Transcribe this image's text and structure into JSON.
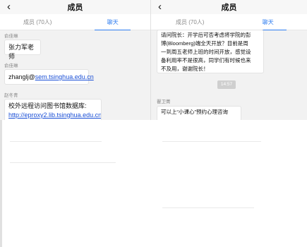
{
  "left": {
    "title": "成员",
    "tabs": [
      "成员 (70人)",
      "聊天"
    ],
    "messages": [
      {
        "sender": "俞佳琳",
        "text": "张力军老师"
      },
      {
        "sender": "俞佳琳",
        "text_prefix": "zhanglj@",
        "link": "sem.tsinghua.edu.cn"
      },
      {
        "sender": "赵冬青",
        "text_prefix": "校外远程访问图书馆数据库: ",
        "link": "http://eproxy2.lib.tsinghua.edu.cn"
      }
    ]
  },
  "right": {
    "title": "成员",
    "tabs": [
      "成员 (70人)",
      "聊天"
    ],
    "message_lines": [
      "请问院长：开学后可否考虑将学院的彭",
      "博(Bloomberg)端全天开放？目前是周",
      "一到周五老师上班的时间开放，感觉设",
      "备利用率不是很高，同学们有时候也来",
      "不及用，谢谢院长！"
    ],
    "time": "14:57",
    "next_sender": "瞿卫菁",
    "next_text": "可以上“小课心”预约心理咨询"
  }
}
